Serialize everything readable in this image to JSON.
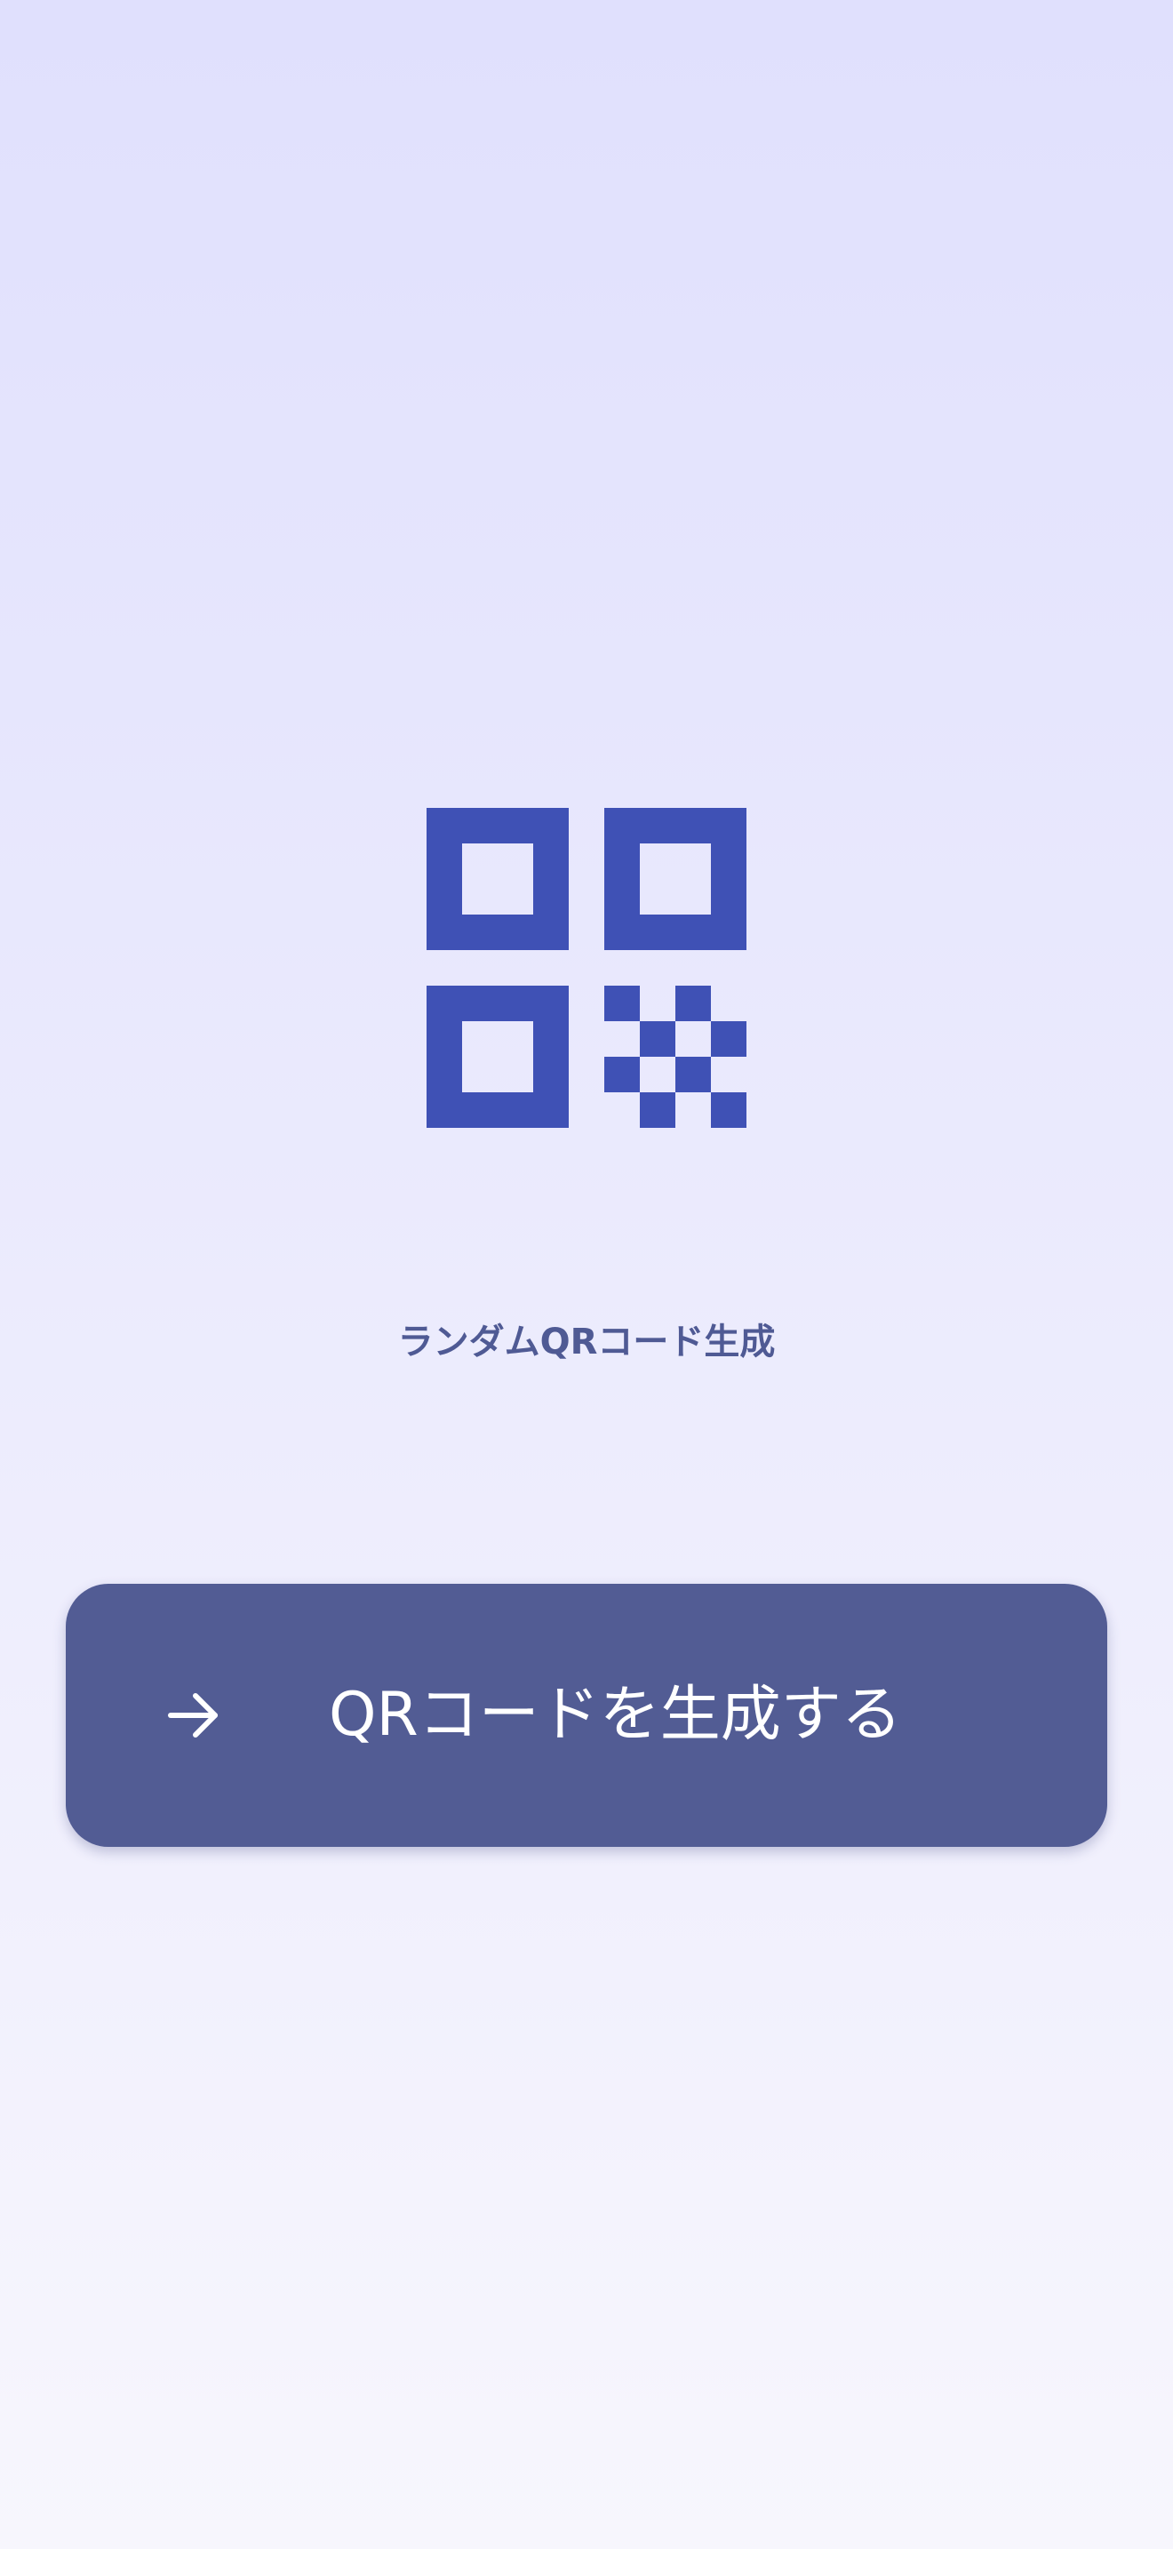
{
  "app": {
    "title": "ランダムQRコード生成",
    "logo_icon": "qr-code-icon"
  },
  "generate_button": {
    "label": "QRコードを生成する",
    "icon": "arrow-right-icon"
  },
  "colors": {
    "brand_blue": "#3f51b5",
    "title_text": "#4f5a94",
    "button_bg": "#525c94",
    "button_text": "#ffffff",
    "background_top": "#e0e0fd",
    "background_bottom": "#f7f6fd"
  }
}
